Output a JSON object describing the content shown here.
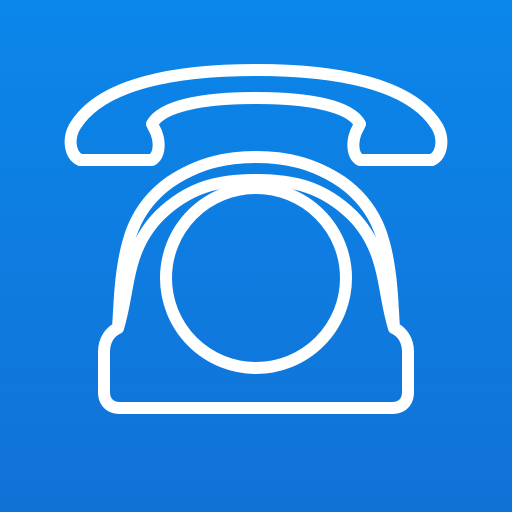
{
  "icon": {
    "name": "telephone-icon",
    "background_top": "#0b86ea",
    "background_bottom": "#1172d6",
    "stroke_color": "#ffffff"
  }
}
